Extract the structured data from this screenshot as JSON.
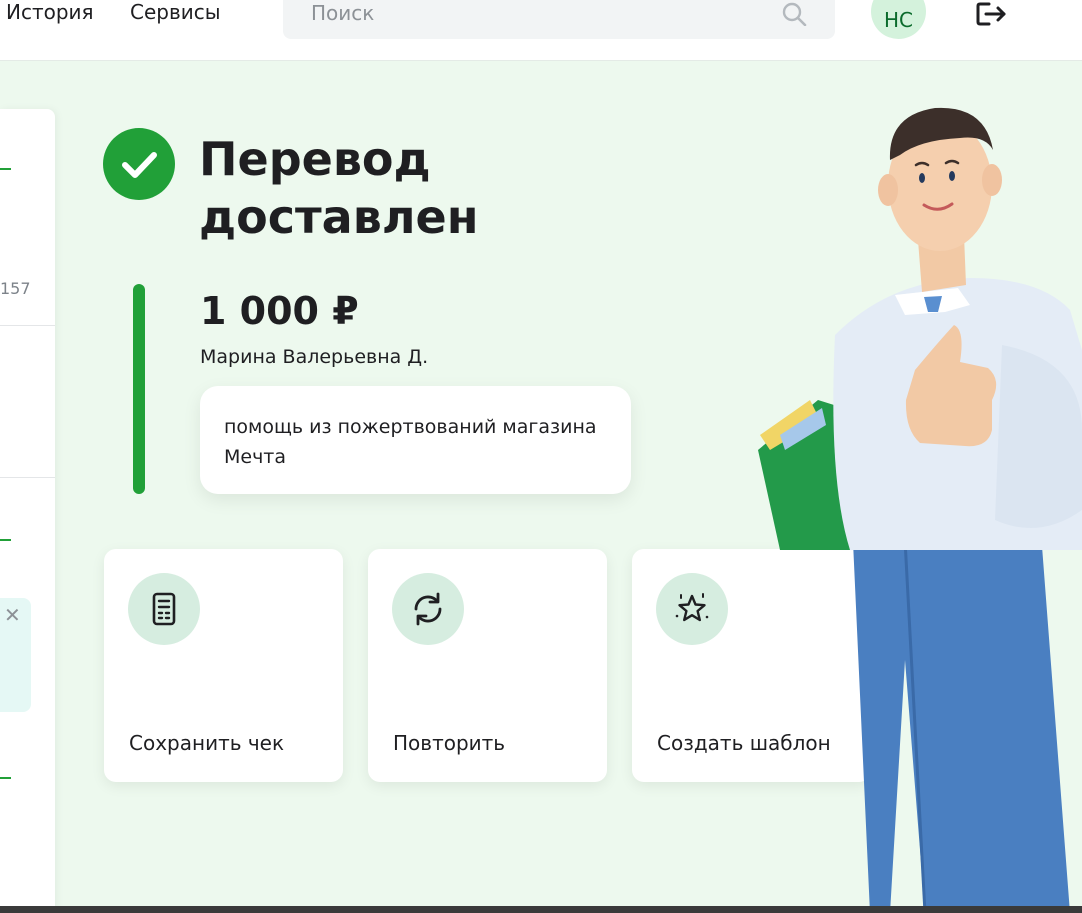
{
  "header": {
    "nav": [
      {
        "label": "История"
      },
      {
        "label": "Сервисы"
      }
    ],
    "search": {
      "placeholder": "Поиск"
    },
    "avatar_initials": "НС",
    "icons": {
      "search": "search-icon",
      "logout": "logout-icon"
    }
  },
  "left_panel": {
    "partial_number": "157",
    "notice_close": "✕"
  },
  "status": {
    "title": "Перевод доставлен",
    "amount": "1 000 ₽",
    "recipient": "Марина Валерьевна Д.",
    "message": "помощь из пожертвований магазина Мечта",
    "icon": "check-circle-icon"
  },
  "actions": [
    {
      "label": "Сохранить чек",
      "icon": "receipt-icon"
    },
    {
      "label": "Повторить",
      "icon": "refresh-icon"
    },
    {
      "label": "Создать шаблон",
      "icon": "star-icon"
    }
  ],
  "colors": {
    "accent": "#21a038",
    "background": "#edf9ee",
    "icon_circle": "#d6ede0"
  }
}
